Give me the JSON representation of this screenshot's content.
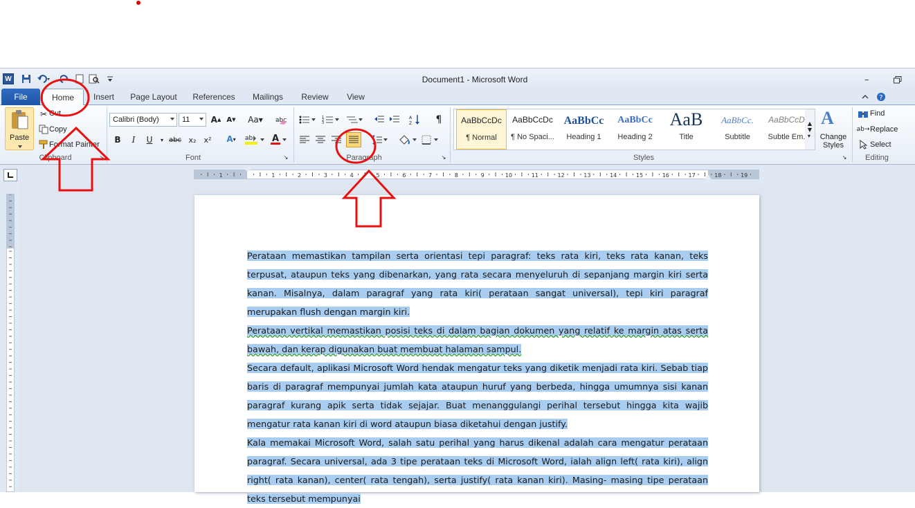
{
  "window": {
    "title": "Document1 - Microsoft Word",
    "app_icon": "W"
  },
  "tabs": [
    "File",
    "Home",
    "Insert",
    "Page Layout",
    "References",
    "Mailings",
    "Review",
    "View"
  ],
  "clipboard": {
    "paste": "Paste",
    "cut": "Cut",
    "copy": "Copy",
    "format_painter": "Format Painter",
    "group": "Clipboard"
  },
  "font": {
    "family": "Calibri (Body)",
    "size": "11",
    "group": "Font",
    "bold": "B",
    "italic": "I",
    "underline": "U",
    "strike": "abc",
    "sub": "x₂",
    "sup": "x²"
  },
  "paragraph": {
    "group": "Paragraph",
    "pilcrow": "¶"
  },
  "styles": {
    "group": "Styles",
    "items": [
      {
        "preview": "AaBbCcDc",
        "name": "¶ Normal"
      },
      {
        "preview": "AaBbCcDc",
        "name": "¶ No Spaci..."
      },
      {
        "preview": "AaBbCc",
        "name": "Heading 1"
      },
      {
        "preview": "AaBbCc",
        "name": "Heading 2"
      },
      {
        "preview": "AaB",
        "name": "Title"
      },
      {
        "preview": "AaBbCc.",
        "name": "Subtitle"
      },
      {
        "preview": "AaBbCcDc",
        "name": "Subtle Em..."
      }
    ],
    "change_styles": "Change Styles"
  },
  "editing": {
    "group": "Editing",
    "find": "Find",
    "replace": "Replace",
    "select": "Select"
  },
  "ruler": {
    "numbers": [
      "2",
      "1",
      "1",
      "2",
      "3",
      "4",
      "5",
      "6",
      "7",
      "8",
      "9",
      "10",
      "11",
      "12",
      "13",
      "14",
      "15",
      "16",
      "17",
      "18",
      "19"
    ]
  },
  "document": {
    "paragraphs": [
      "Perataan memastikan tampilan serta orientasi tepi paragraf: teks rata kiri, teks rata kanan, teks terpusat, ataupun teks yang dibenarkan, yang rata secara menyeluruh di sepanjang margin kiri serta kanan. Misalnya, dalam paragraf yang rata kiri( perataan sangat universal), tepi kiri paragraf merupakan flush dengan margin kiri.",
      "Perataan vertikal memastikan posisi teks di dalam bagian dokumen yang relatif ke margin atas serta bawah, dan kerap digunakan buat membuat halaman sampul.",
      "Secara default, aplikasi Microsoft Word hendak mengatur teks yang diketik menjadi rata kiri. Sebab tiap baris di paragraf mempunyai jumlah kata ataupun huruf yang berbeda, hingga umumnya sisi kanan paragraf kurang apik serta tidak sejajar. Buat menanggulangi perihal tersebut hingga kita wajib mengatur rata kanan kiri di word ataupun biasa diketahui dengan justify.",
      "Kala memakai Microsoft Word, salah satu perihal yang harus dikenal adalah cara mengatur perataan paragraf. Secara universal, ada 3 tipe perataan teks di Microsoft Word, ialah align left( rata kiri), align right( rata kanan), center( rata tengah), serta justify( rata kanan kiri). Masing- masing tipe perataan teks tersebut mempunyai"
    ]
  },
  "colors": {
    "file_tab": "#2b63b5",
    "annotation": "#e81010",
    "selection": "#a9cdf0",
    "active_style": "#f2b73a"
  }
}
